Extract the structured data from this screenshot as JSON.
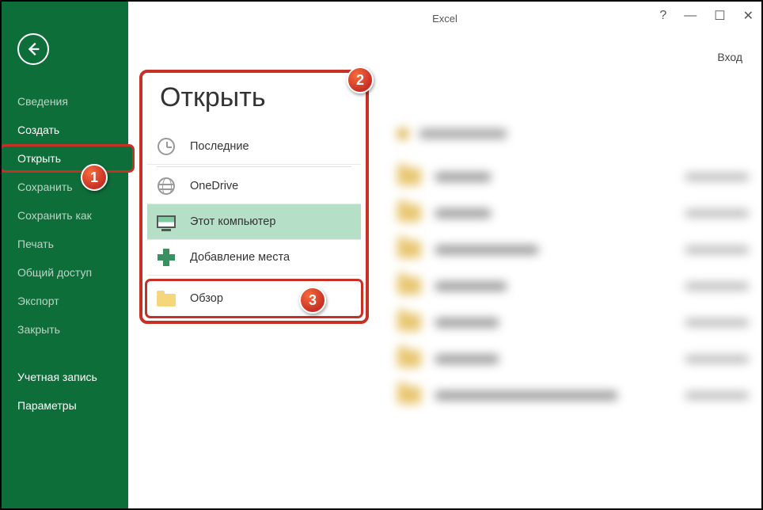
{
  "app": {
    "title": "Excel",
    "signin": "Вход"
  },
  "window_controls": {
    "help": "?",
    "minimize": "—",
    "maximize": "☐",
    "close": "✕"
  },
  "sidebar": {
    "items": [
      {
        "label": "Сведения"
      },
      {
        "label": "Создать"
      },
      {
        "label": "Открыть"
      },
      {
        "label": "Сохранить"
      },
      {
        "label": "Сохранить как"
      },
      {
        "label": "Печать"
      },
      {
        "label": "Общий доступ"
      },
      {
        "label": "Экспорт"
      },
      {
        "label": "Закрыть"
      },
      {
        "label": "Учетная запись"
      },
      {
        "label": "Параметры"
      }
    ]
  },
  "open_panel": {
    "title": "Открыть",
    "locations": {
      "recent": "Последние",
      "onedrive": "OneDrive",
      "this_pc": "Этот компьютер",
      "add_place": "Добавление места",
      "browse": "Обзор"
    }
  },
  "annotations": {
    "b1": "1",
    "b2": "2",
    "b3": "3"
  }
}
